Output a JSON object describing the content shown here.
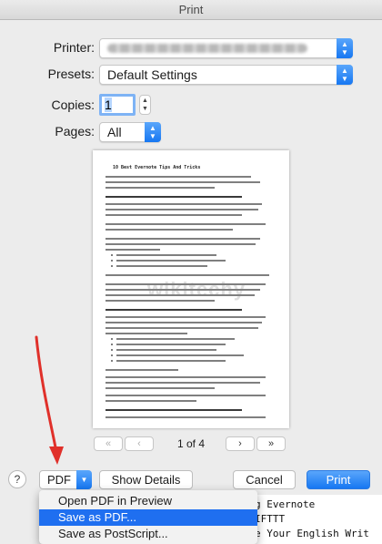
{
  "window": {
    "title": "Print"
  },
  "printer": {
    "label": "Printer:"
  },
  "presets": {
    "label": "Presets:",
    "value": "Default Settings"
  },
  "copies": {
    "label": "Copies:",
    "value": "1"
  },
  "pages": {
    "label": "Pages:",
    "value": "All"
  },
  "preview": {
    "doc_title": "10 Best Evernote Tips And Tricks",
    "watermark": "wikitechy",
    "page_indicator": "1 of 4",
    "first_label": "«",
    "prev_label": "‹",
    "next_label": "›",
    "last_label": "»"
  },
  "footer": {
    "help_label": "?",
    "pdf_label": "PDF",
    "show_details_label": "Show Details",
    "cancel_label": "Cancel",
    "print_label": "Print"
  },
  "pdf_menu": {
    "items": [
      {
        "label": "Open PDF in Preview"
      },
      {
        "label": "Save as PDF..."
      },
      {
        "label": "Save as PostScript..."
      }
    ]
  },
  "background_terminal": {
    "lines": [
      "g Evernote",
      "IFTTT",
      "e Your English Writ"
    ]
  },
  "colors": {
    "accent": "#1677f2",
    "annotation_arrow": "#e0302a"
  }
}
